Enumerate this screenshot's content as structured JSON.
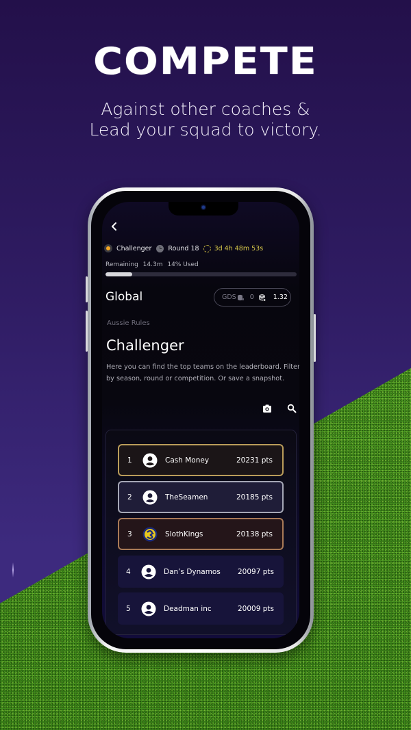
{
  "hero": {
    "title": "COMPETE",
    "subtitle_line1": "Against other coaches &",
    "subtitle_line2": "Lead your squad to victory."
  },
  "status": {
    "league": "Challenger",
    "round": "Round 18",
    "countdown": "3d 4h 48m 53s",
    "remaining_label": "Remaining",
    "remaining_value": "14.3m",
    "used_label": "14% Used",
    "used_fraction": 0.14
  },
  "header": {
    "title": "Global",
    "gds_label": "GDS",
    "gds_count": "0",
    "gds_value": "1.32"
  },
  "page": {
    "sport": "Aussie Rules",
    "title": "Challenger",
    "description": "Here you can find the top teams on the leaderboard. Filter by season, round or competition. Or save a snapshot."
  },
  "icons": {
    "back": "chevron-left-icon",
    "snapshot": "camera-icon",
    "search": "search-icon"
  },
  "leaderboard": [
    {
      "rank": "1",
      "name": "Cash Money",
      "points": "20231 pts",
      "avatar": "user-icon",
      "tier": "gold"
    },
    {
      "rank": "2",
      "name": "TheSeamen",
      "points": "20185 pts",
      "avatar": "user-icon",
      "tier": "silver"
    },
    {
      "rank": "3",
      "name": "SlothKings",
      "points": "20138 pts",
      "avatar": "team-logo",
      "tier": "bronze"
    },
    {
      "rank": "4",
      "name": "Dan’s Dynamos",
      "points": "20097 pts",
      "avatar": "user-icon",
      "tier": "plain"
    },
    {
      "rank": "5",
      "name": "Deadman inc",
      "points": "20009 pts",
      "avatar": "user-icon",
      "tier": "plain"
    }
  ],
  "colors": {
    "accent_gold": "#d8c84a",
    "league_dot": "#f5a623",
    "tier_gold": "#b99c5a",
    "tier_silver": "#a5a7b6",
    "tier_bronze": "#a97a57"
  }
}
